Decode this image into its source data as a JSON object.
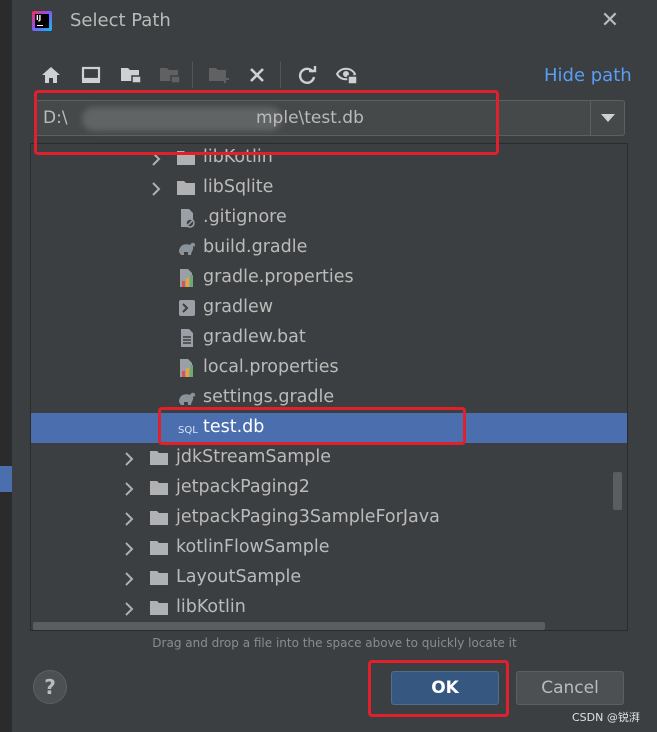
{
  "dialog": {
    "title": "Select Path",
    "close_glyph": "✕",
    "app_icon_text": "IJ"
  },
  "toolbar": {
    "buttons": [
      {
        "name": "home-icon"
      },
      {
        "name": "desktop-icon"
      },
      {
        "name": "project-folder-icon"
      },
      {
        "name": "module-folder-icon"
      },
      {
        "name": "new-folder-icon"
      },
      {
        "name": "delete-icon"
      },
      {
        "name": "refresh-icon"
      },
      {
        "name": "show-hidden-icon"
      }
    ],
    "hide_path_label": "Hide path"
  },
  "path": {
    "prefix": "D:\\",
    "suffix": "mple\\test.db"
  },
  "tree": {
    "rows": [
      {
        "label": "libKotlin",
        "icon": "folder",
        "expandable": true
      },
      {
        "label": "libSqlite",
        "icon": "folder",
        "expandable": true
      },
      {
        "label": ".gitignore",
        "icon": "ignore-file",
        "expandable": false
      },
      {
        "label": "build.gradle",
        "icon": "gradle",
        "expandable": false
      },
      {
        "label": "gradle.properties",
        "icon": "properties",
        "expandable": false
      },
      {
        "label": "gradlew",
        "icon": "shell",
        "expandable": false
      },
      {
        "label": "gradlew.bat",
        "icon": "text-file",
        "expandable": false
      },
      {
        "label": "local.properties",
        "icon": "properties",
        "expandable": false
      },
      {
        "label": "settings.gradle",
        "icon": "gradle",
        "expandable": false
      },
      {
        "label": "test.db",
        "icon": "sql",
        "expandable": false,
        "selected": true
      },
      {
        "label": "jdkStreamSample",
        "icon": "folder",
        "expandable": true
      },
      {
        "label": "jetpackPaging2",
        "icon": "folder",
        "expandable": true
      },
      {
        "label": "jetpackPaging3SampleForJava",
        "icon": "folder",
        "expandable": true
      },
      {
        "label": "kotlinFlowSample",
        "icon": "folder",
        "expandable": true
      },
      {
        "label": "LayoutSample",
        "icon": "folder",
        "expandable": true
      },
      {
        "label": "libKotlin",
        "icon": "folder",
        "expandable": true
      }
    ],
    "sql_icon_text": "SQL"
  },
  "hint": "Drag and drop a file into the space above to quickly locate it",
  "buttons": {
    "help": "?",
    "ok": "OK",
    "cancel": "Cancel"
  },
  "watermark": "CSDN @锐湃",
  "colors": {
    "background": "#3c3f41",
    "selection": "#4b6eaf",
    "link": "#589df6",
    "ok_button": "#365880",
    "annotation": "#e0202a"
  }
}
